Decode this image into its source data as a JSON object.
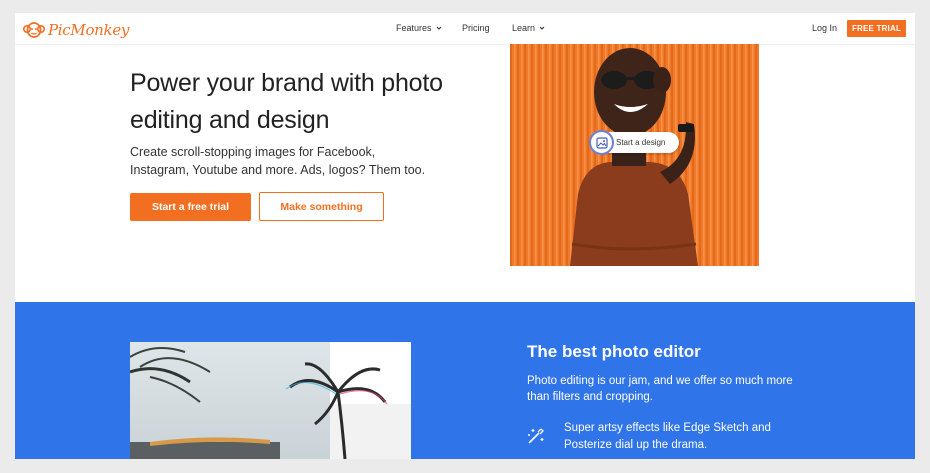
{
  "header": {
    "logo_text": "PicMonkey",
    "nav": {
      "features": "Features",
      "pricing": "Pricing",
      "learn": "Learn"
    },
    "login": "Log In",
    "free_trial": "FREE TRIAL"
  },
  "hero": {
    "title": "Power your brand with photo editing and design",
    "subtitle": "Create scroll-stopping images for Facebook, Instagram, Youtube and more. Ads, logos? Them too.",
    "primary_button": "Start a free trial",
    "secondary_button": "Make something",
    "image_pill": "Start a design"
  },
  "feature_section": {
    "title": "The best photo editor",
    "description": "Photo editing is our jam, and we offer so much more than filters and cropping.",
    "feature_1": "Super artsy effects like Edge Sketch and Posterize dial up the drama."
  },
  "colors": {
    "brand_orange": "#f26f21",
    "section_blue": "#2f74e8",
    "page_bg": "#ebebeb"
  },
  "icons": [
    "monkey-logo-icon",
    "chevron-down-icon",
    "image-icon",
    "magic-wand-icon"
  ]
}
